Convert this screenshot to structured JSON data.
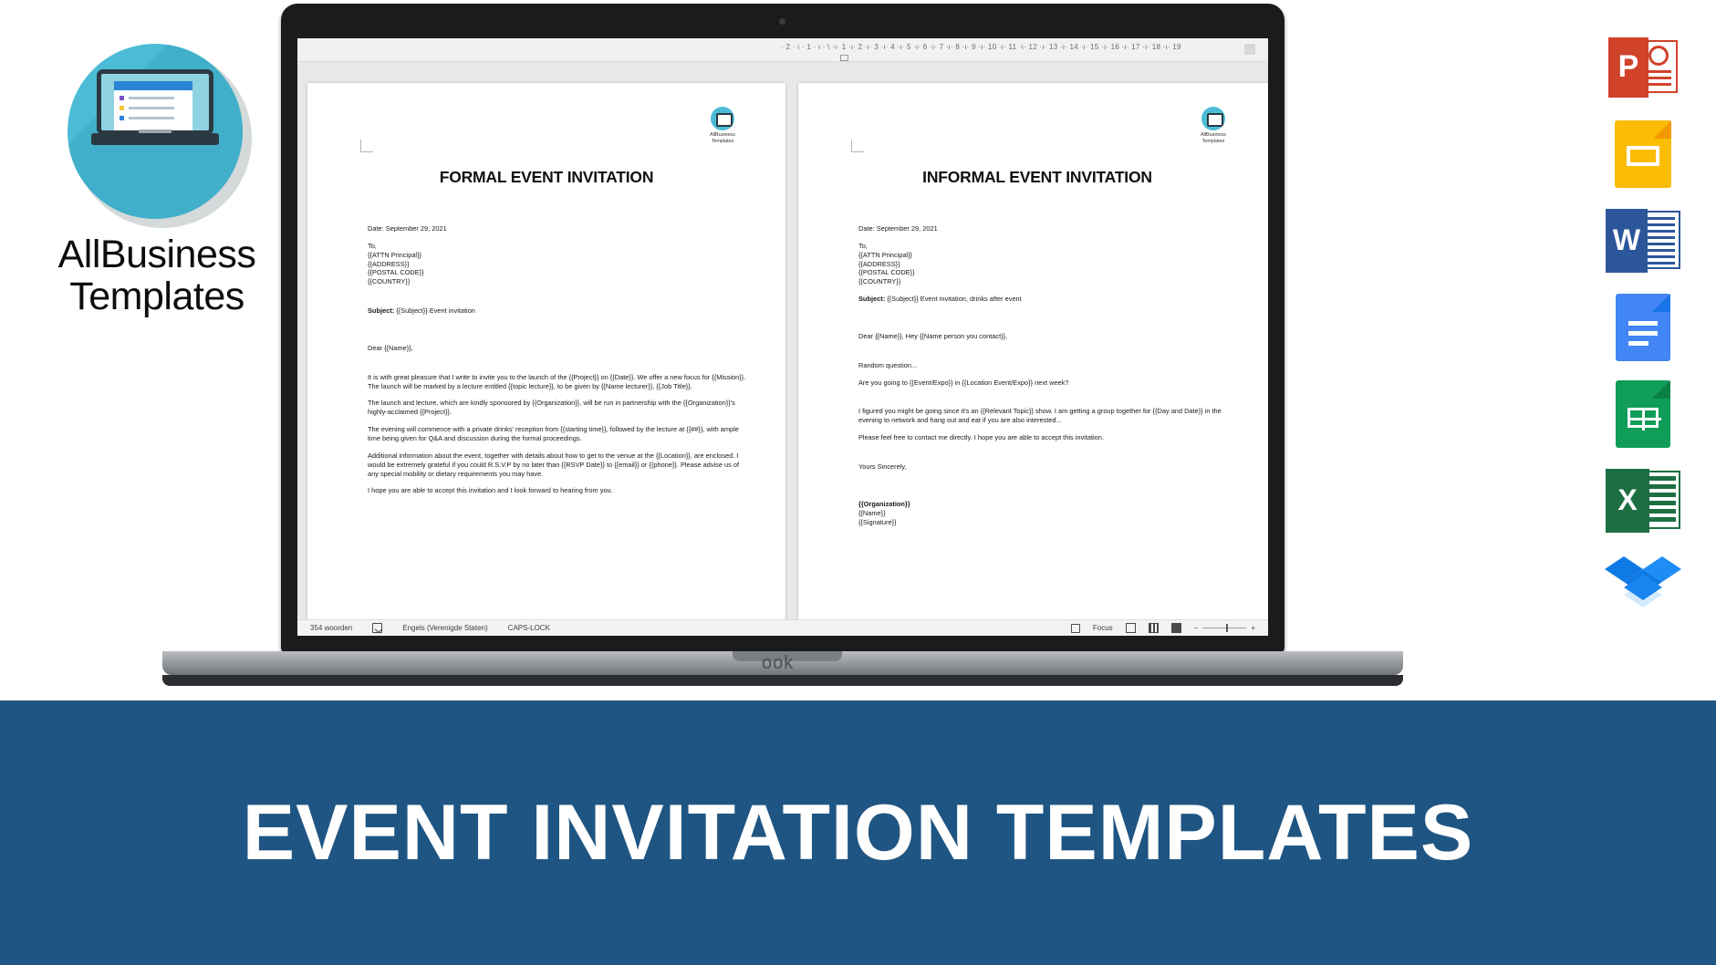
{
  "brand": {
    "name_line1": "AllBusiness",
    "name_line2": "Templates",
    "logo_icon": "laptop-circle-icon",
    "accent_color": "#4cbcd6"
  },
  "banner": {
    "text": "EVENT INVITATION TEMPLATES",
    "background_color": "#1f5582",
    "text_color": "#ffffff"
  },
  "word_window": {
    "ruler": {
      "scale": "· 2 · ι · 1 · ι · \\ ·ι· 1 ·ι· 2 ·ι· 3 ·ι· 4 ·ι· 5 ·ι· 6 ·ι· 7 ·ι· 8 ·ι· 9 ·ι· 10 ·ι· 11 ·ι· 12 ·ι· 13 ·ι· 14 ·ι· 15 ·ι· 16 ·ι· 17 ·ι· 18 ·ι· 19"
    },
    "status_bar": {
      "word_count": "354 woorden",
      "proofing_icon": "proofing-errors-icon",
      "language": "Engels (Verenigde Staten)",
      "caps_lock": "CAPS-LOCK",
      "focus_label": "Focus",
      "view_read_icon": "read-mode-icon",
      "view_print_icon": "print-layout-icon",
      "view_web_icon": "web-layout-icon",
      "zoom_out": "−",
      "zoom_in": "+"
    }
  },
  "documents": [
    {
      "id": "formal",
      "logo_text_line1": "AllBusiness",
      "logo_text_line2": "Templates",
      "title": "FORMAL EVENT INVITATION",
      "date": "Date: September 29, 2021",
      "to_label": "To,",
      "to_lines": [
        "{{ATTN Principal}}",
        "{{ADDRESS}}",
        "{{POSTAL CODE}}",
        "{{COUNTRY}}"
      ],
      "subject_label": "Subject:",
      "subject_value": "{{Subject}} Event invitation",
      "salutation": "Dear {{Name}},",
      "paragraphs": [
        "It is with great pleasure that I write to invite you to the launch of the {{Project}} on {{Date}}. We offer a new focus for {{Mission}}. The launch will be marked by a lecture entitled {{topic lecture}}, to be given by {{Name lecturer}}, {{Job Title}}.",
        "The launch and lecture, which are kindly sponsored by {{Organization}}, will be run in partnership with the {{Organization}}'s highly-acclaimed {{Project}}.",
        "The evening will commence with a private drinks' reception from {{starting time}}, followed by the lecture at {{##}}, with ample time being given for Q&A and discussion during the formal proceedings.",
        "Additional information about the event, together with details about how to get to the venue at the {{Location}}, are enclosed. I would be extremely grateful if you could R.S.V.P by no later than {{RSVP Date}} to {{email}} or {{phone}}. Please advise us of any special mobility or dietary requirements you may have.",
        "I hope you are able to accept this invitation and I look forward to hearing from you."
      ]
    },
    {
      "id": "informal",
      "logo_text_line1": "AllBusiness",
      "logo_text_line2": "Templates",
      "title": "INFORMAL EVENT INVITATION",
      "date": "Date: September 29, 2021",
      "to_label": "To,",
      "to_lines": [
        "{{ATTN Principal}}",
        "{{ADDRESS}}",
        "{{POSTAL CODE}}",
        "{{COUNTRY}}"
      ],
      "subject_label": "Subject:",
      "subject_value": "{{Subject}} Event invitation, drinks after event",
      "salutation": "Dear {{Name}}, Hey {{Name person you contact}},",
      "paragraphs": [
        "Random question...",
        "Are you going to {{Event/Expo}} in {{Location Event/Expo}} next week?",
        "I figured you might be going since it's an {{Relevant Topic}} show. I am getting a group together for {{Day and Date}} in the evening to network and hang out and eat if you are also interested...",
        "Please feel free to contact me directly. I hope you are able to accept this invitation."
      ],
      "closing": "Yours Sincerely,",
      "signature_lines": [
        "{{Organization}}",
        "{{Name}}",
        "{{Signature}}"
      ]
    }
  ],
  "app_icons": [
    {
      "name": "powerpoint-icon",
      "letter": "P",
      "color": "#d0422a"
    },
    {
      "name": "google-slides-icon",
      "letter": "",
      "color": "#fbbc04"
    },
    {
      "name": "word-icon",
      "letter": "W",
      "color": "#2b579a"
    },
    {
      "name": "google-docs-icon",
      "letter": "",
      "color": "#4285f4"
    },
    {
      "name": "google-sheets-icon",
      "letter": "",
      "color": "#0f9d58"
    },
    {
      "name": "excel-icon",
      "letter": "X",
      "color": "#1d6f42"
    },
    {
      "name": "dropbox-icon",
      "letter": "",
      "color": "#0061ff"
    }
  ]
}
